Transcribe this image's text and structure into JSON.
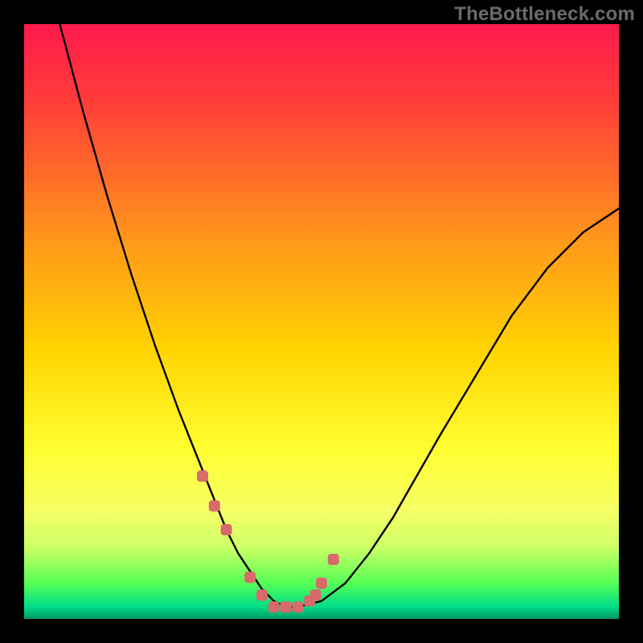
{
  "watermark": "TheBottleneck.com",
  "colors": {
    "background": "#000000",
    "curve": "#000000",
    "marker": "#d86a6a",
    "gradient_stops": [
      {
        "pos": 0,
        "hex": "#ff1a4d"
      },
      {
        "pos": 12,
        "hex": "#ff3a3a"
      },
      {
        "pos": 25,
        "hex": "#ff6a2a"
      },
      {
        "pos": 37,
        "hex": "#ff9a1a"
      },
      {
        "pos": 55,
        "hex": "#ffd400"
      },
      {
        "pos": 72,
        "hex": "#ffff33"
      },
      {
        "pos": 82,
        "hex": "#f6ff66"
      },
      {
        "pos": 88,
        "hex": "#ccff66"
      },
      {
        "pos": 94,
        "hex": "#55ff55"
      },
      {
        "pos": 98,
        "hex": "#00dd88"
      },
      {
        "pos": 100,
        "hex": "#009966"
      }
    ]
  },
  "chart_data": {
    "type": "line",
    "title": "",
    "xlabel": "",
    "ylabel": "",
    "xlim": [
      0,
      100
    ],
    "ylim": [
      0,
      100
    ],
    "series": [
      {
        "name": "bottleneck-curve",
        "x": [
          6,
          10,
          14,
          18,
          22,
          26,
          30,
          34,
          36,
          38,
          40,
          42,
          44,
          46,
          50,
          54,
          58,
          62,
          66,
          70,
          76,
          82,
          88,
          94,
          100
        ],
        "y": [
          100,
          85,
          71,
          58,
          46,
          35,
          25,
          15,
          11,
          8,
          5,
          3,
          2,
          2,
          3,
          6,
          11,
          17,
          24,
          31,
          41,
          51,
          59,
          65,
          69
        ]
      }
    ],
    "markers": {
      "name": "highlight-points",
      "x": [
        30,
        32,
        34,
        38,
        40,
        42,
        44,
        46,
        48,
        49,
        50,
        52
      ],
      "y": [
        24,
        19,
        15,
        7,
        4,
        2,
        2,
        2,
        3,
        4,
        6,
        10
      ]
    }
  }
}
